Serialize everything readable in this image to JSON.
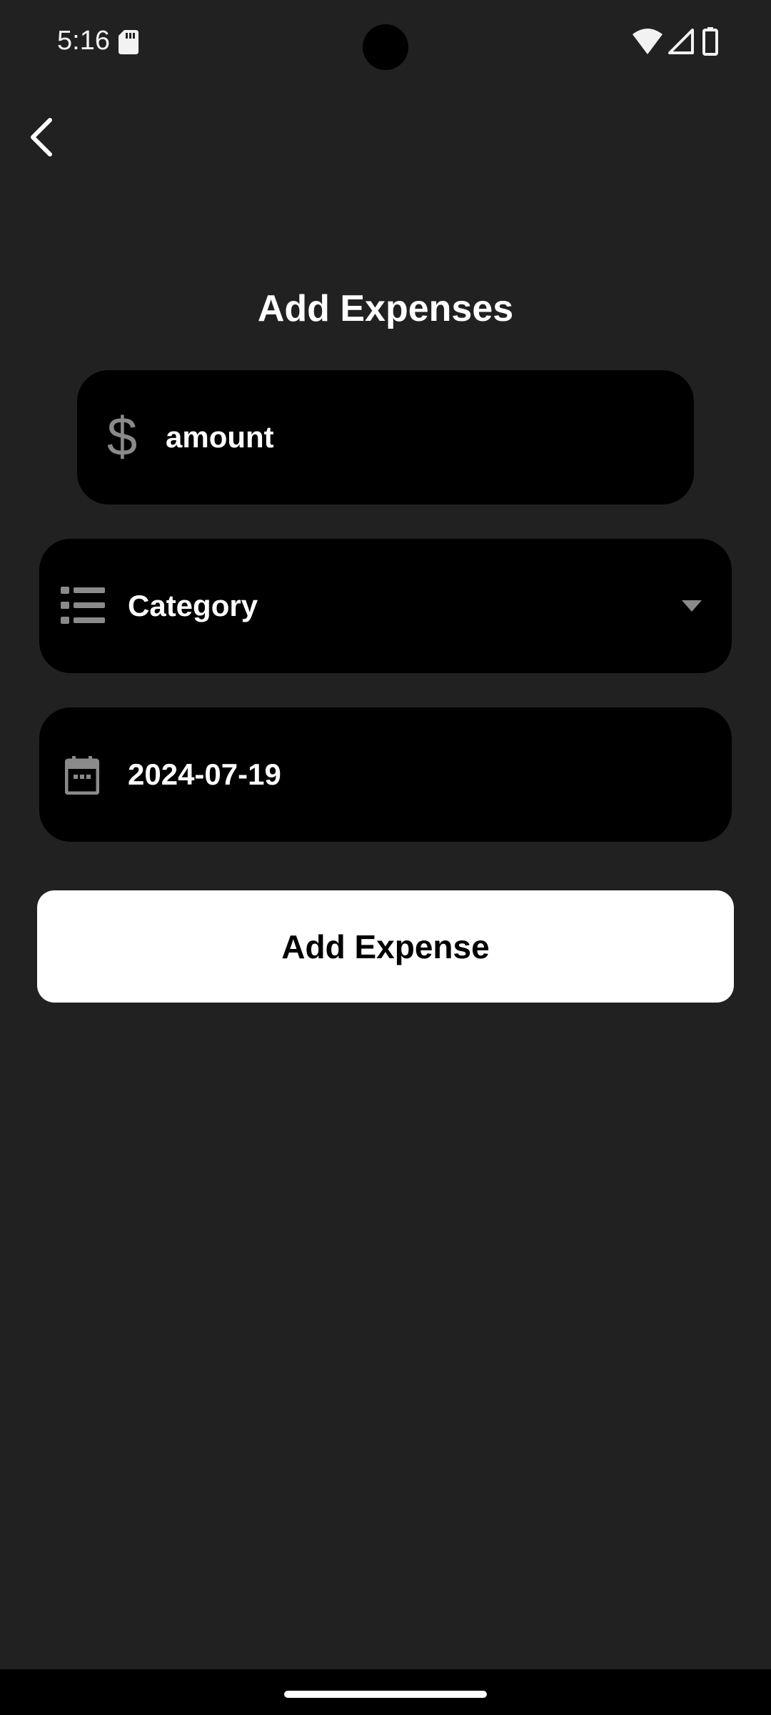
{
  "status_bar": {
    "time": "5:16",
    "icons": [
      "sd-card-icon",
      "wifi-icon",
      "signal-icon",
      "battery-icon"
    ]
  },
  "header": {
    "back_icon": "chevron-left-icon",
    "title": "Add Expenses"
  },
  "form": {
    "amount": {
      "icon": "dollar-icon",
      "glyph": "$",
      "placeholder": "amount"
    },
    "category": {
      "icon": "list-icon",
      "label": "Category",
      "dropdown_icon": "dropdown-arrow-icon"
    },
    "date": {
      "icon": "calendar-icon",
      "value": "2024-07-19"
    },
    "submit_label": "Add Expense"
  },
  "colors": {
    "background": "#212121",
    "field_background": "#000000",
    "button_background": "#ffffff",
    "icon_gray": "#8a8a8a",
    "text": "#ffffff"
  }
}
